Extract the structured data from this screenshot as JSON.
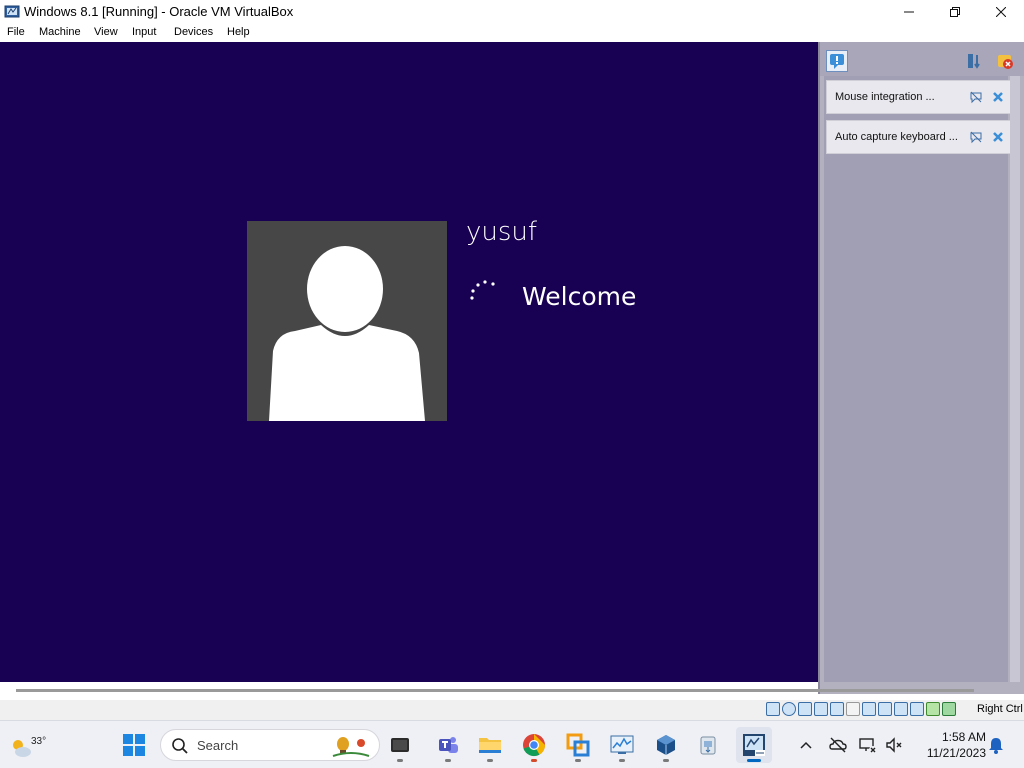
{
  "window": {
    "title": "Windows 8.1 [Running] - Oracle VM VirtualBox",
    "controls": {
      "minimize": "—",
      "maximize": "❐",
      "close": "✕"
    }
  },
  "menu": {
    "items": [
      {
        "label": "File"
      },
      {
        "label": "Machine"
      },
      {
        "label": "View"
      },
      {
        "label": "Input"
      },
      {
        "label": "Devices"
      },
      {
        "label": "Help"
      }
    ]
  },
  "vm": {
    "username": "yusuf",
    "status": "Welcome",
    "background_color": "#180052"
  },
  "notifications": {
    "items": [
      {
        "label": "Mouse integration ..."
      },
      {
        "label": "Auto capture keyboard ..."
      }
    ]
  },
  "statusbar": {
    "host_key": "Right Ctrl",
    "icons": [
      "hard-disk-icon",
      "optical-drive-icon",
      "audio-icon",
      "network-icon",
      "usb-icon",
      "shared-folders-icon",
      "display-icon",
      "recording-icon",
      "video-capture-icon",
      "virtualization-icon",
      "cpu-icon",
      "mouse-integration-icon",
      "keyboard-capture-icon"
    ]
  },
  "taskbar": {
    "weather": {
      "temperature": "33°"
    },
    "search": {
      "placeholder": "Search"
    },
    "apps": [
      {
        "name": "terminal-icon"
      },
      {
        "name": "teams-icon"
      },
      {
        "name": "file-explorer-icon"
      },
      {
        "name": "chrome-icon"
      },
      {
        "name": "vmware-icon"
      },
      {
        "name": "performance-monitor-icon"
      },
      {
        "name": "virtualbox-icon"
      },
      {
        "name": "app-installer-icon"
      },
      {
        "name": "windows-8-1-vm-icon"
      }
    ],
    "clock": {
      "time": "1:58 AM",
      "date": "11/21/2023"
    }
  }
}
